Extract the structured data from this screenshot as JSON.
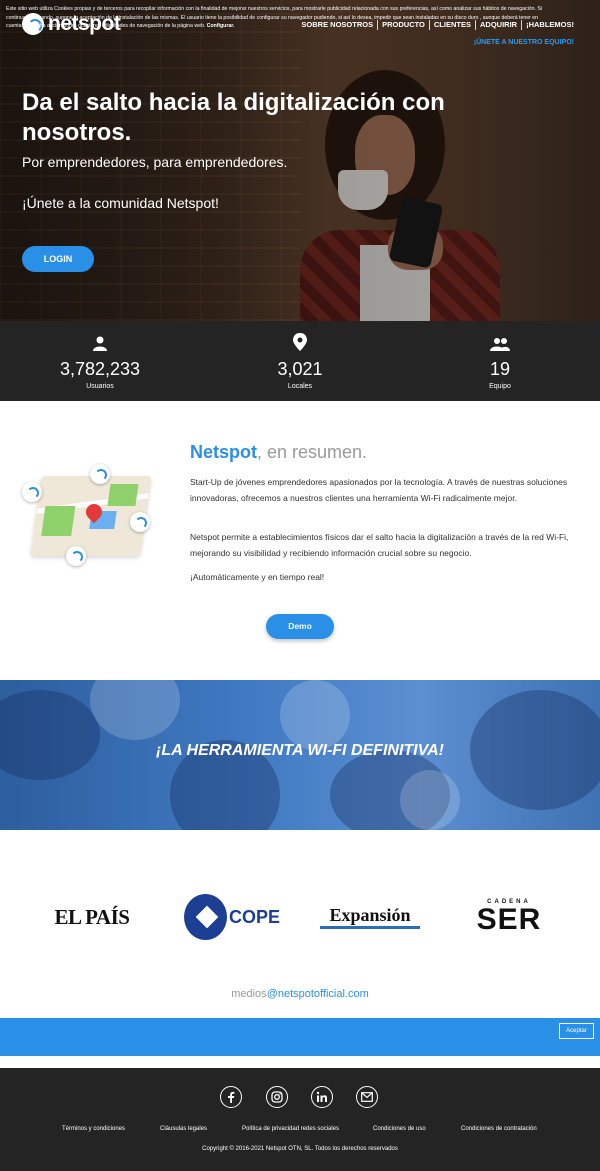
{
  "header": {
    "brand": "netspot",
    "nav": [
      "SOBRE NOSOTROS",
      "PRODUCTO",
      "CLIENTES",
      "ADQUIRIR",
      "¡HABLEMOS!"
    ],
    "join_team": "¡ÚNETE A NUESTRO EQUIPO!"
  },
  "hero": {
    "title": "Da el salto hacia la digitalización con nosotros.",
    "subtitle": "Por emprendedores, para emprendedores.",
    "community": "¡Únete a la comunidad Netspot!",
    "login_label": "LOGIN"
  },
  "stats": [
    {
      "icon": "person-icon",
      "value": "3,782,233",
      "label": "Usuarios"
    },
    {
      "icon": "location-pin-icon",
      "value": "3,021",
      "label": "Locales"
    },
    {
      "icon": "group-icon",
      "value": "19",
      "label": "Equipo"
    }
  ],
  "summary": {
    "title_brand": "Netspot",
    "title_rest": ", en resumen.",
    "p1": "Start-Up de jóvenes emprendedores apasionados por la tecnología. A través de nuestras soluciones innovadoras, ofrecemos a nuestros clientes una herramienta Wi-Fi radicalmente mejor.",
    "p2": "Netspot permite a establecimientos físicos dar el salto hacia la digitalización a través de la red Wi-Fi, mejorando su visibilidad y recibiendo información crucial sobre su negocio.",
    "p3": "¡Automáticamente y en tiempo real!",
    "demo_label": "Demo"
  },
  "banner": {
    "text": "¡LA HERRAMIENTA WI-FI DEFINITIVA!"
  },
  "media": {
    "logos": [
      "EL PAÍS",
      "COPE",
      "Expansión",
      "CADENA",
      "SER"
    ],
    "email_prefix": "medios",
    "email_domain": "@netspotofficial.com"
  },
  "cookie": {
    "text": "Este sitio web utiliza Cookies propias y de terceros para recopilar información con la finalidad de mejorar nuestros servicios, para mostrarle publicidad relacionada con sus preferencias, así como analizar sus hábitos de navegación. Si continua navegando, supone la aceptación de la instalación de las mismas. El usuario tiene la posibilidad de configurar su navegador pudiendo, si así lo desea, impedir que sean instaladas en su disco duro , aunque deberá tener en cuenta que dicha acción podrá ocasionar dificultades de navegación de la página web.",
    "configure": "Configurar.",
    "accept_label": "Aceptar"
  },
  "footer": {
    "social": [
      "f",
      "ig",
      "in",
      "mail"
    ],
    "links": [
      "Términos y condiciones",
      "Cláusulas legales",
      "Política de privacidad redes sociales",
      "Condiciones de uso",
      "Condiciones de contratación"
    ],
    "copyright": "Copyright © 2016-2021 Netspot OTN, SL. Todos los derechos reservados"
  },
  "colors": {
    "accent": "#2a8fe6",
    "dark": "#242424"
  }
}
